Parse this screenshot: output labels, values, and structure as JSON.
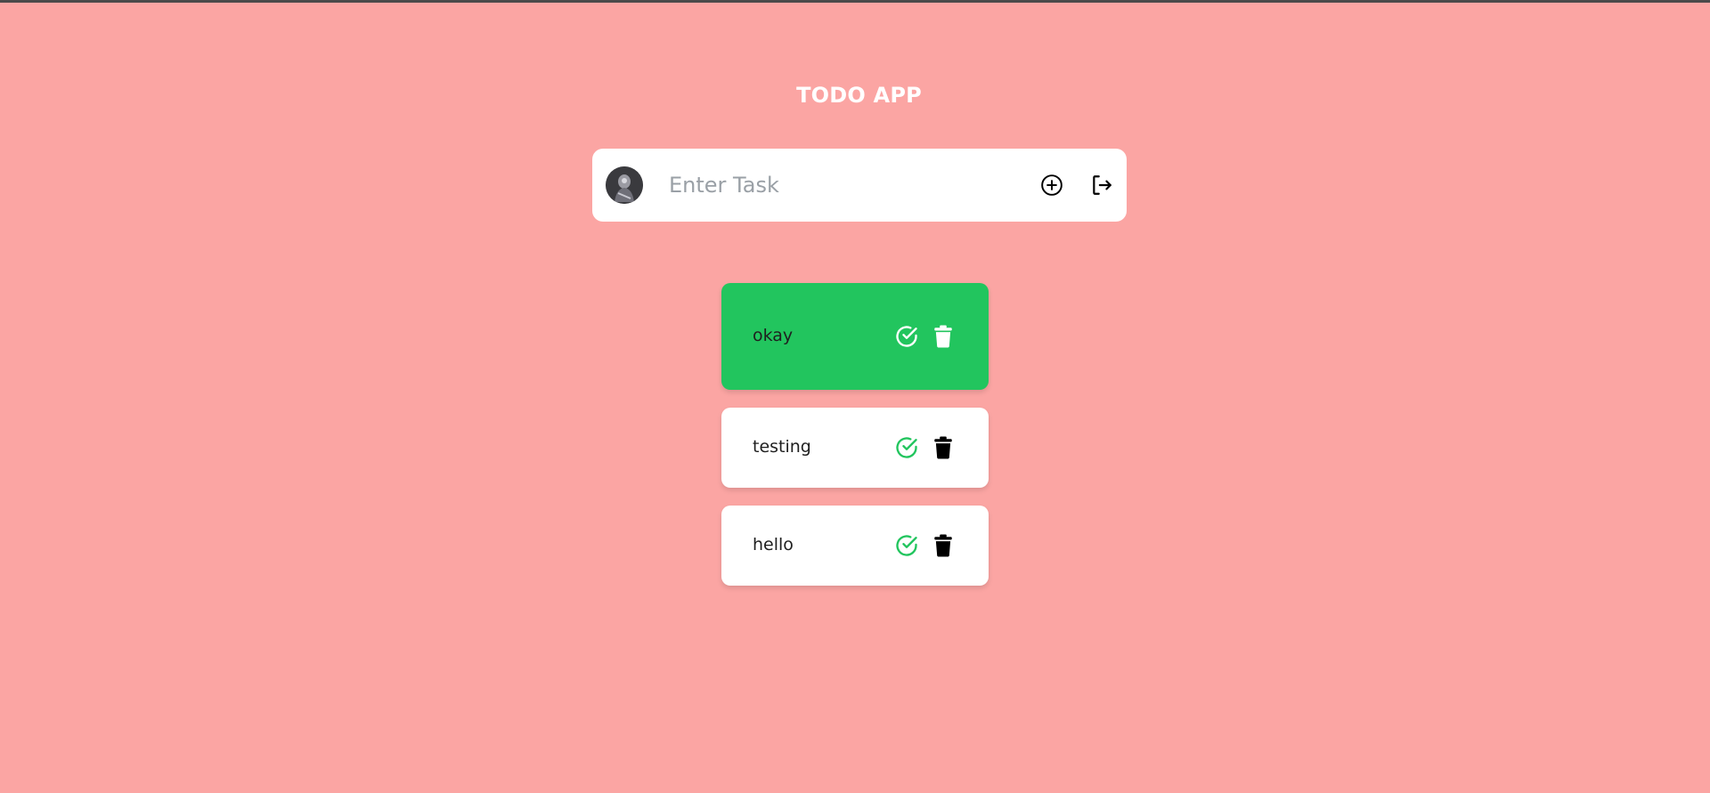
{
  "app": {
    "title": "TODO APP"
  },
  "task_bar": {
    "placeholder": "Enter Task",
    "value": "",
    "icons": {
      "avatar": "user-avatar",
      "add": "plus-circle-icon",
      "logout": "logout-icon"
    }
  },
  "todos": [
    {
      "text": "okay",
      "completed": true
    },
    {
      "text": "testing",
      "completed": false
    },
    {
      "text": "hello",
      "completed": false
    }
  ],
  "colors": {
    "background": "#fba5a3",
    "completed_card": "#22c55e",
    "check_icon": "#22c55e",
    "card": "#ffffff"
  }
}
